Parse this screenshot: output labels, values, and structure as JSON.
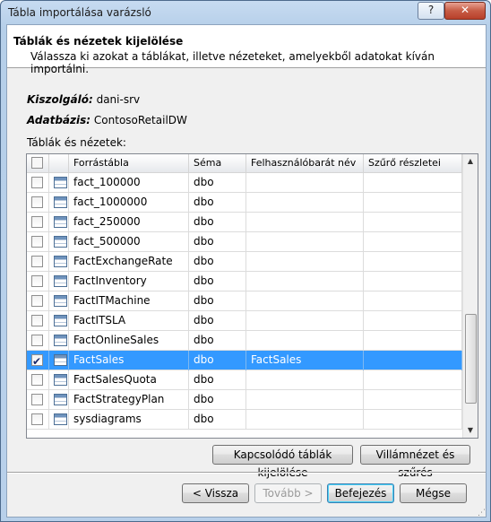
{
  "window": {
    "title": "Tábla importálása varázsló",
    "help_label": "?",
    "close_label": "✕"
  },
  "header": {
    "title": "Táblák és nézetek kijelölése",
    "subtitle": "Válassza ki azokat a táblákat, illetve nézeteket, amelyekből adatokat kíván importálni."
  },
  "server": {
    "label": "Kiszolgáló:",
    "value": "dani-srv"
  },
  "database": {
    "label": "Adatbázis:",
    "value": "ContosoRetailDW"
  },
  "tables_label": "Táblák és nézetek:",
  "grid": {
    "columns": [
      "Forrástábla",
      "Séma",
      "Felhasználóbarát név",
      "Szűrő részletei"
    ],
    "rows": [
      {
        "checked": false,
        "table": "fact_100000",
        "schema": "dbo",
        "friendly": "",
        "filter": ""
      },
      {
        "checked": false,
        "table": "fact_1000000",
        "schema": "dbo",
        "friendly": "",
        "filter": ""
      },
      {
        "checked": false,
        "table": "fact_250000",
        "schema": "dbo",
        "friendly": "",
        "filter": ""
      },
      {
        "checked": false,
        "table": "fact_500000",
        "schema": "dbo",
        "friendly": "",
        "filter": ""
      },
      {
        "checked": false,
        "table": "FactExchangeRate",
        "schema": "dbo",
        "friendly": "",
        "filter": ""
      },
      {
        "checked": false,
        "table": "FactInventory",
        "schema": "dbo",
        "friendly": "",
        "filter": ""
      },
      {
        "checked": false,
        "table": "FactITMachine",
        "schema": "dbo",
        "friendly": "",
        "filter": ""
      },
      {
        "checked": false,
        "table": "FactITSLA",
        "schema": "dbo",
        "friendly": "",
        "filter": ""
      },
      {
        "checked": false,
        "table": "FactOnlineSales",
        "schema": "dbo",
        "friendly": "",
        "filter": ""
      },
      {
        "checked": true,
        "table": "FactSales",
        "schema": "dbo",
        "friendly": "FactSales",
        "filter": "",
        "selected": true
      },
      {
        "checked": false,
        "table": "FactSalesQuota",
        "schema": "dbo",
        "friendly": "",
        "filter": ""
      },
      {
        "checked": false,
        "table": "FactStrategyPlan",
        "schema": "dbo",
        "friendly": "",
        "filter": ""
      },
      {
        "checked": false,
        "table": "sysdiagrams",
        "schema": "dbo",
        "friendly": "",
        "filter": ""
      }
    ]
  },
  "buttons": {
    "select_related": "Kapcsolódó táblák kijelölése",
    "preview_filter": "Villámnézet és szűrés",
    "back": "< Vissza",
    "next": "Tovább >",
    "finish": "Befejezés",
    "cancel": "Mégse"
  }
}
